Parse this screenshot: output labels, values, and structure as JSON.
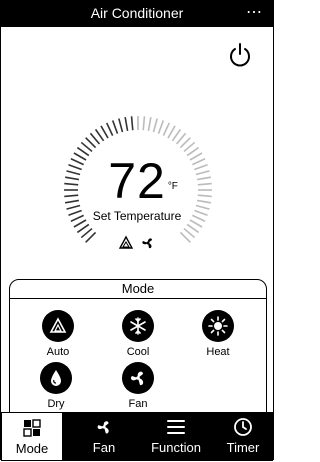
{
  "header": {
    "title": "Air Conditioner",
    "menu_glyph": "⋯"
  },
  "thermostat": {
    "temperature": "72",
    "unit": "°F",
    "label": "Set Temperature",
    "status_icons": [
      "auto-mode-icon",
      "fan-icon"
    ]
  },
  "mode_panel": {
    "title": "Mode",
    "modes": [
      {
        "label": "Auto",
        "icon": "auto-icon"
      },
      {
        "label": "Cool",
        "icon": "snowflake-icon"
      },
      {
        "label": "Heat",
        "icon": "sun-icon"
      },
      {
        "label": "Dry",
        "icon": "drop-icon"
      },
      {
        "label": "Fan",
        "icon": "fan-icon"
      }
    ]
  },
  "tabs": [
    {
      "label": "Mode",
      "icon": "mode-icon",
      "active": true
    },
    {
      "label": "Fan",
      "icon": "fan-icon"
    },
    {
      "label": "Function",
      "icon": "menu-icon"
    },
    {
      "label": "Timer",
      "icon": "clock-icon"
    }
  ],
  "colors": {
    "primary": "#000000",
    "background": "#ffffff",
    "tick_active": "#333333",
    "tick_inactive": "#bbbbbb"
  }
}
